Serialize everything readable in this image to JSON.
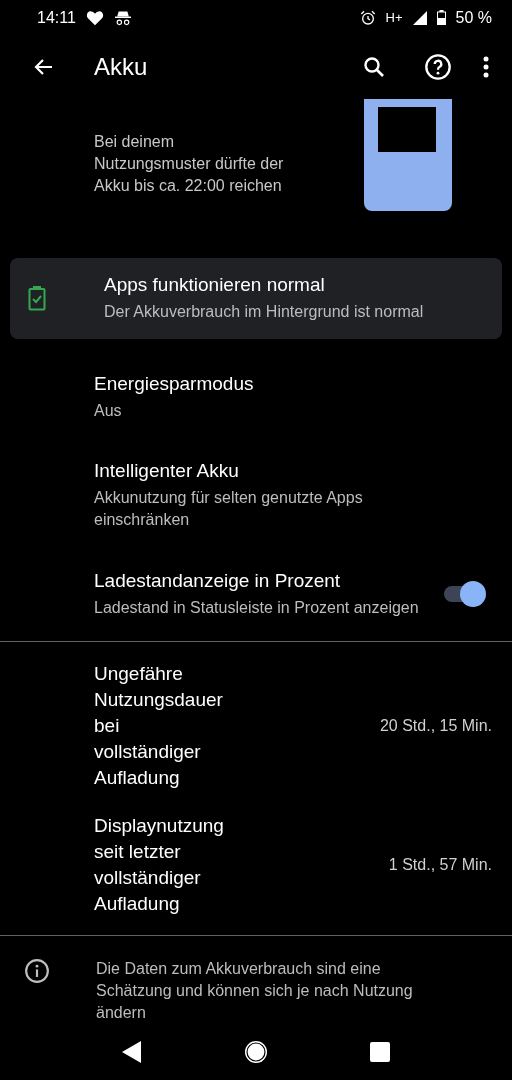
{
  "status_bar": {
    "time": "14:11",
    "network": "H+",
    "battery": "50 %"
  },
  "toolbar": {
    "title": "Akku"
  },
  "summary": {
    "estimate": "Bei deinem Nutzungsmuster dürfte der Akku bis ca. 22:00 reichen"
  },
  "status_card": {
    "title": "Apps funktionieren normal",
    "subtitle": "Der Akkuverbrauch im Hintergrund ist normal"
  },
  "settings": [
    {
      "kind": "plain",
      "title": "Energiesparmodus",
      "subtitle": "Aus"
    },
    {
      "kind": "plain",
      "title": "Intelligenter Akku",
      "subtitle": "Akkunutzung für selten genutzte Apps einschränken"
    },
    {
      "kind": "switch",
      "title": "Ladestandanzeige in Prozent",
      "subtitle": "Ladestand in Statusleiste in Prozent anzeigen",
      "on": true
    }
  ],
  "usage": [
    {
      "label": "Ungefähre Nutzungsdauer bei vollständiger Aufladung",
      "value": "20 Std., 15 Min."
    },
    {
      "label": "Displaynutzung seit letzter vollständiger Aufladung",
      "value": "1 Std., 57 Min."
    }
  ],
  "footer": {
    "note": "Die Daten zum Akkuverbrauch sind eine Schätzung und können sich je nach Nutzung ändern"
  }
}
